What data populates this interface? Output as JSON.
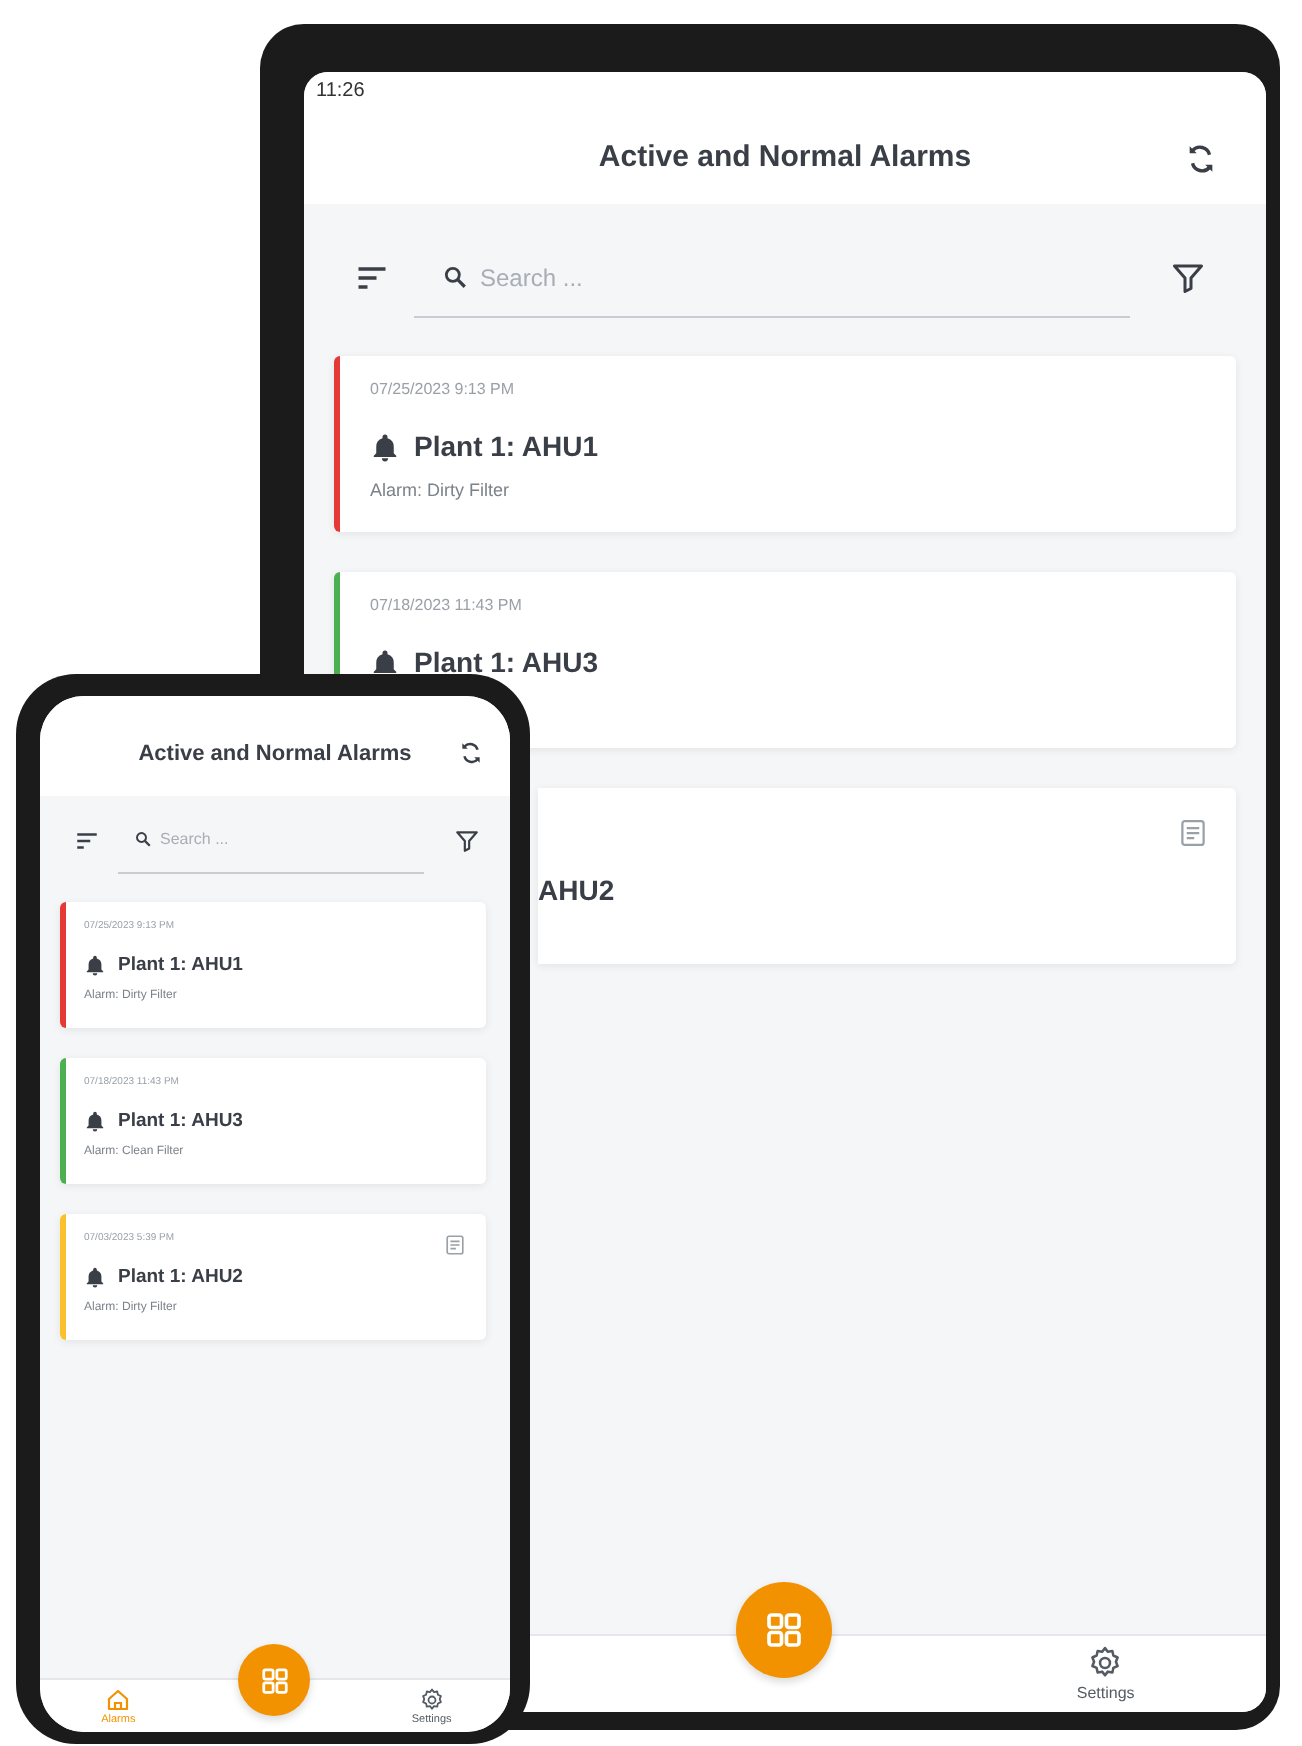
{
  "tablet": {
    "status_bar": {
      "time": "11:26"
    },
    "header": {
      "title": "Active and Normal Alarms"
    },
    "search": {
      "placeholder": "Search ..."
    },
    "cards": [
      {
        "kind": "full",
        "date": "07/25/2023 9:13 PM",
        "title": "Plant 1: AHU1",
        "alarm": "Alarm: Dirty Filter",
        "color": "#e53935",
        "note": false
      },
      {
        "kind": "full",
        "date": "07/18/2023 11:43 PM",
        "title": "Plant 1: AHU3",
        "color": "#4caf50",
        "note": false
      },
      {
        "kind": "covered",
        "title": "AHU2",
        "note": true
      }
    ],
    "nav": [
      {
        "kind": "settings",
        "label": "Settings",
        "selected": false
      }
    ]
  },
  "phone": {
    "header": {
      "title": "Active and Normal Alarms"
    },
    "search": {
      "placeholder": "Search ..."
    },
    "cards": [
      {
        "kind": "full",
        "date": "07/25/2023 9:13 PM",
        "title": "Plant 1: AHU1",
        "alarm": "Alarm: Dirty Filter",
        "color": "#e53935",
        "note": false
      },
      {
        "kind": "full",
        "date": "07/18/2023 11:43 PM",
        "title": "Plant 1: AHU3",
        "alarm": "Alarm: Clean Filter",
        "color": "#4caf50",
        "note": false
      },
      {
        "kind": "full",
        "date": "07/03/2023 5:39 PM",
        "title": "Plant 1: AHU2",
        "alarm": "Alarm: Dirty Filter",
        "color": "#fbc02d",
        "note": true
      }
    ],
    "nav": [
      {
        "kind": "home",
        "label": "Alarms",
        "selected": true
      },
      {
        "kind": "settings",
        "label": "Settings",
        "selected": false
      }
    ]
  }
}
